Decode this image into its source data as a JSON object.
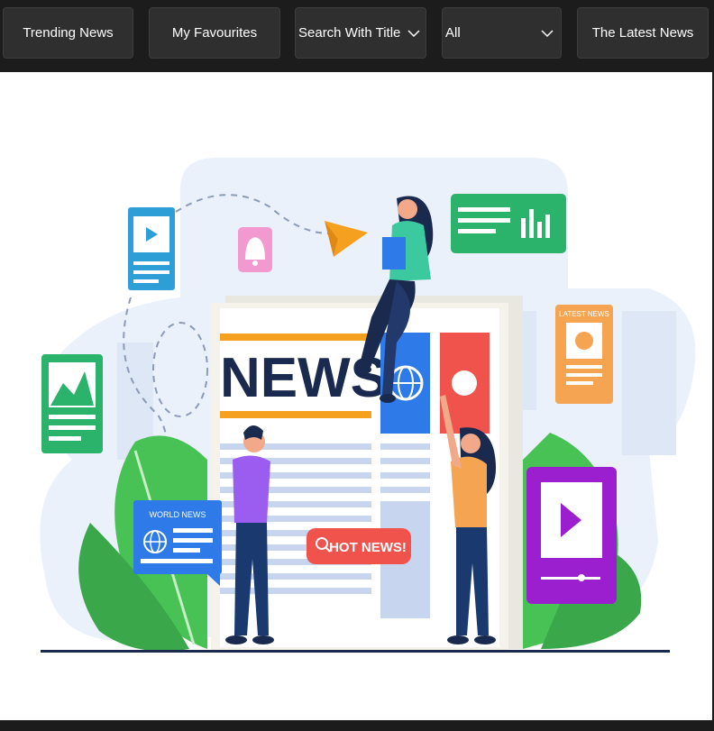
{
  "toolbar": {
    "trending_label": "Trending News",
    "favourites_label": "My Favourites",
    "search_select_value": "Search With Title",
    "category_select_value": "All",
    "latest_label": "The Latest News"
  },
  "illustration": {
    "headline": "NEWS",
    "hot_news_badge": "HOT NEWS!",
    "world_news_card": "WORLD NEWS",
    "latest_news_card": "LATEST NEWS"
  },
  "colors": {
    "toolbar_bg": "#1c1c1c",
    "button_bg": "#2f2f2f",
    "navy": "#1a2a4f",
    "accent_orange": "#f5a01e",
    "accent_blue": "#2d7ae8",
    "accent_red": "#f0534c",
    "accent_green": "#2bb36b",
    "accent_purple": "#9b1fcf"
  }
}
